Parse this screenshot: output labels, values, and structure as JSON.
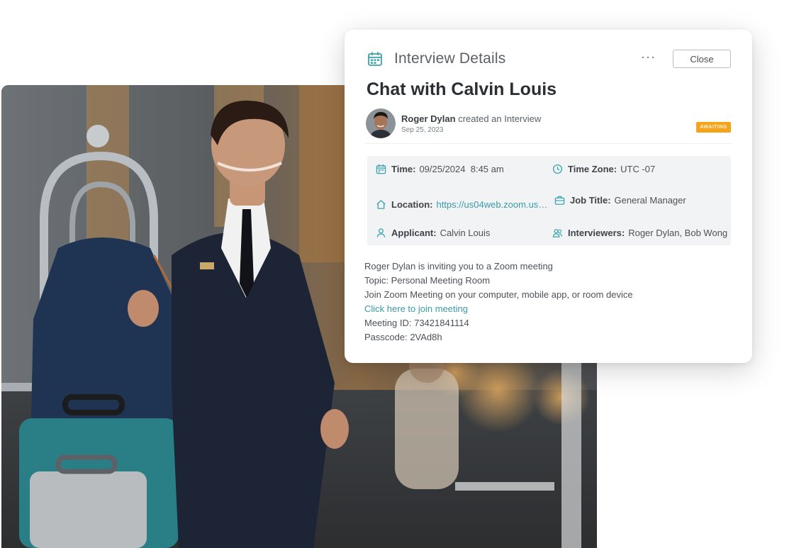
{
  "card": {
    "header_title": "Interview Details",
    "more_label": "···",
    "close_label": "Close",
    "interview_title": "Chat with Calvin Louis",
    "creator": {
      "name": "Roger Dylan",
      "action": "created an Interview",
      "date": "Sep 25, 2023"
    },
    "status": "AWAITING",
    "details": {
      "time": {
        "label": "Time:",
        "value": "09/25/2024  8:45 am"
      },
      "time_zone": {
        "label": "Time Zone:",
        "value": "UTC -07"
      },
      "location": {
        "label": "Location:",
        "value": "https://us04web.zoom.us/j..."
      },
      "job_title": {
        "label": "Job Title:",
        "value": "General Manager"
      },
      "applicant": {
        "label": "Applicant:",
        "value": "Calvin Louis"
      },
      "interviewers": {
        "label": "Interviewers:",
        "value": "Roger Dylan, Bob Wong"
      }
    },
    "description": {
      "line1": "Roger Dylan is inviting you to a Zoom meeting",
      "line2": "Topic: Personal Meeting Room",
      "line3": "Join Zoom Meeting on your computer, mobile app, or room device",
      "link": "Click here to join meeting",
      "meeting_id": "Meeting ID: 73421841114",
      "passcode": "Passcode: 2VAd8h"
    }
  },
  "colors": {
    "accent": "#3a9ba6",
    "badge": "#f5a31a",
    "title": "#2b2f33"
  },
  "icons": {
    "calendar": "calendar-icon",
    "more": "more-icon",
    "clock": "clock-icon",
    "home": "home-icon",
    "briefcase": "briefcase-icon",
    "user": "user-icon",
    "users": "users-icon"
  }
}
